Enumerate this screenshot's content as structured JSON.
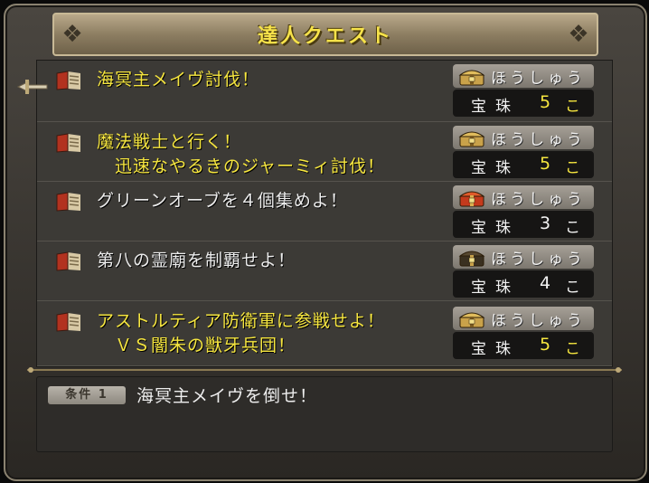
{
  "header": {
    "title": "達人クエスト"
  },
  "reward_label": "ほうしゅう",
  "quests": [
    {
      "title": "海冥主メイヴ討伐！",
      "done": false,
      "chest": "gold-chest-icon",
      "item": "宝珠",
      "qty": "5",
      "unit": "こ",
      "qty_color": "yellow"
    },
    {
      "title": "魔法戦士と行く！\n　迅速なやるきのジャーミィ討伐！",
      "done": false,
      "chest": "gold-chest-icon",
      "item": "宝珠",
      "qty": "5",
      "unit": "こ",
      "qty_color": "yellow"
    },
    {
      "title": "グリーンオーブを４個集めよ！",
      "done": true,
      "chest": "red-chest-icon",
      "item": "宝珠",
      "qty": "3",
      "unit": "こ",
      "qty_color": "white"
    },
    {
      "title": "第八の霊廟を制覇せよ！",
      "done": true,
      "chest": "dark-chest-icon",
      "item": "宝珠",
      "qty": "4",
      "unit": "こ",
      "qty_color": "white"
    },
    {
      "title": "アストルティア防衛軍に参戦せよ！\n　ＶＳ闇朱の獣牙兵団！",
      "done": false,
      "chest": "gold-chest-icon",
      "item": "宝珠",
      "qty": "5",
      "unit": "こ",
      "qty_color": "yellow"
    }
  ],
  "condition": {
    "badge": "条件 1",
    "text": "海冥主メイヴを倒せ！"
  },
  "colors": {
    "accent_yellow": "#f6e63f",
    "panel": "#3c3a36",
    "frame": "#4a4640"
  }
}
